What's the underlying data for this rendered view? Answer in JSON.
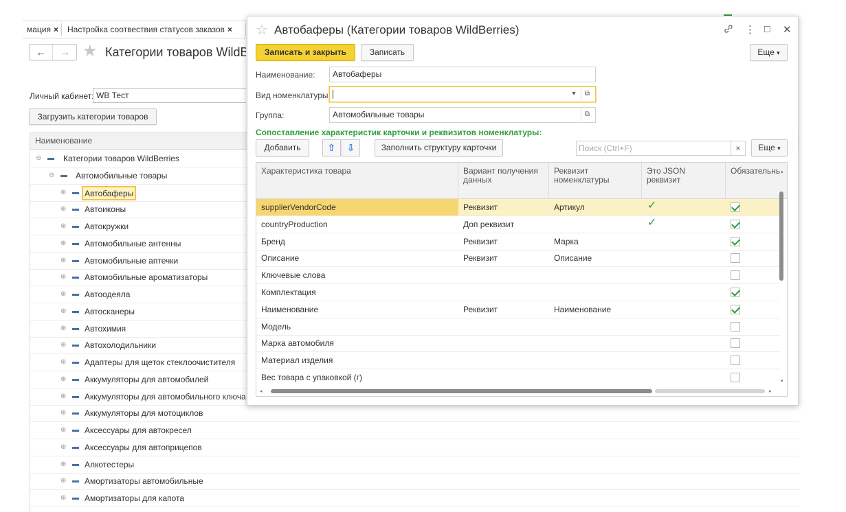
{
  "bg": {
    "tabs": [
      {
        "label": "мация",
        "close": "×"
      },
      {
        "label": "Настройка соотвествия статусов заказов",
        "close": "×"
      }
    ],
    "nav": {
      "back": "←",
      "forward": "→"
    },
    "star": "★",
    "title": "Категории товаров WildBerries",
    "cabinet_label": "Личный кабинет:",
    "cabinet_value": "WB Тест",
    "load_button": "Загрузить категории товаров",
    "tree_header": "Наименование",
    "tree": [
      {
        "label": "Категории товаров WildBerries",
        "level": 0,
        "toggle": "⊖"
      },
      {
        "label": "Автомобильные товары",
        "level": 1,
        "toggle": "⊖"
      },
      {
        "label": "Автобаферы",
        "level": 2,
        "toggle": "⊕",
        "selected": true
      },
      {
        "label": "Автоиконы",
        "level": 2,
        "toggle": "⊕"
      },
      {
        "label": "Автокружки",
        "level": 2,
        "toggle": "⊕"
      },
      {
        "label": "Автомобильные антенны",
        "level": 2,
        "toggle": "⊕"
      },
      {
        "label": "Автомобильные аптечки",
        "level": 2,
        "toggle": "⊕"
      },
      {
        "label": "Автомобильные ароматизаторы",
        "level": 2,
        "toggle": "⊕"
      },
      {
        "label": "Автоодеяла",
        "level": 2,
        "toggle": "⊕"
      },
      {
        "label": "Автосканеры",
        "level": 2,
        "toggle": "⊕"
      },
      {
        "label": "Автохимия",
        "level": 2,
        "toggle": "⊕"
      },
      {
        "label": "Автохолодильники",
        "level": 2,
        "toggle": "⊕"
      },
      {
        "label": "Адаптеры для щеток стеклоочистителя",
        "level": 2,
        "toggle": "⊕"
      },
      {
        "label": "Аккумуляторы для автомобилей",
        "level": 2,
        "toggle": "⊕"
      },
      {
        "label": "Аккумуляторы для автомобильного ключа",
        "level": 2,
        "toggle": "⊕"
      },
      {
        "label": "Аккумуляторы для мотоциклов",
        "level": 2,
        "toggle": "⊕"
      },
      {
        "label": "Аксессуары для автокресел",
        "level": 2,
        "toggle": "⊕"
      },
      {
        "label": "Аксессуары для автоприцепов",
        "level": 2,
        "toggle": "⊕"
      },
      {
        "label": "Алкотестеры",
        "level": 2,
        "toggle": "⊕"
      },
      {
        "label": "Амортизаторы автомобильные",
        "level": 2,
        "toggle": "⊕"
      },
      {
        "label": "Амортизаторы для капота",
        "level": 2,
        "toggle": "⊕"
      }
    ]
  },
  "dialog": {
    "star": "☆",
    "title": "Автобаферы (Категории товаров WildBerries)",
    "icons": {
      "link": "🔗",
      "more": "⋮",
      "maximize": "□",
      "close": "✕"
    },
    "save_close": "Записать и закрыть",
    "save": "Записать",
    "more": "Еще",
    "more_arrow": "▾",
    "name_label": "Наименование:",
    "name_value": "Автобаферы",
    "kind_label": "Вид номенклатуры:",
    "kind_value": "",
    "group_label": "Группа:",
    "group_value": "Автомобильные товары",
    "dropdown_glyph": "▾",
    "open_glyph": "⧉",
    "section_title": "Сопоставление характеристик карточки и реквизитов номенклатуры:",
    "add_button": "Добавить",
    "up": "⇧",
    "down": "⇩",
    "fill_button": "Заполнить структуру карточки",
    "search_placeholder": "Поиск (Ctrl+F)",
    "search_clear": "×",
    "columns": [
      "Характеристика товара",
      "Вариант получения данных",
      "Реквизит номенклатуры",
      "Это JSON реквизит",
      "Обязательный"
    ],
    "columns_visible": [
      "Характеристика товара",
      "Вариант получения данных",
      "Реквизит номенклатуры",
      "Это JSON реквизит",
      "Обязательнь"
    ],
    "rows": [
      {
        "name": "supplierVendorCode",
        "variant": "Реквизит",
        "attr": "Артикул",
        "json": true,
        "required": true,
        "selected": true
      },
      {
        "name": "countryProduction",
        "variant": "Доп реквизит",
        "attr": "",
        "json": true,
        "required": true
      },
      {
        "name": "Бренд",
        "variant": "Реквизит",
        "attr": "Марка",
        "json": false,
        "required": true
      },
      {
        "name": "Описание",
        "variant": "Реквизит",
        "attr": "Описание",
        "json": false,
        "required": false
      },
      {
        "name": "Ключевые слова",
        "variant": "",
        "attr": "",
        "json": false,
        "required": false
      },
      {
        "name": "Комплектация",
        "variant": "",
        "attr": "",
        "json": false,
        "required": true
      },
      {
        "name": "Наименование",
        "variant": "Реквизит",
        "attr": "Наименование",
        "json": false,
        "required": true
      },
      {
        "name": "Модель",
        "variant": "",
        "attr": "",
        "json": false,
        "required": false
      },
      {
        "name": "Марка автомобиля",
        "variant": "",
        "attr": "",
        "json": false,
        "required": false
      },
      {
        "name": "Материал изделия",
        "variant": "",
        "attr": "",
        "json": false,
        "required": false
      },
      {
        "name": "Вес товара с упаковкой (г)",
        "variant": "",
        "attr": "",
        "json": false,
        "required": false
      }
    ],
    "tick_glyph": "✓",
    "scroll_up": "▴",
    "scroll_down": "▾",
    "scroll_left": "◂",
    "scroll_right": "▸"
  }
}
